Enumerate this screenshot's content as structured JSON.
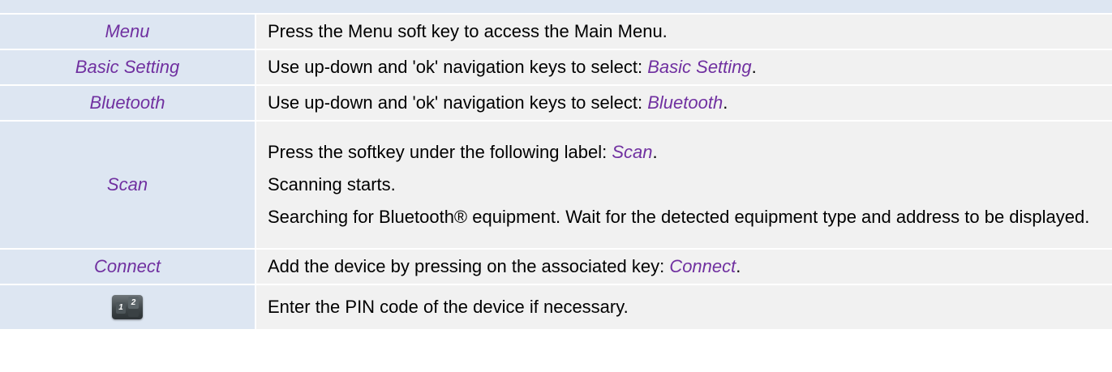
{
  "steps": [
    {
      "label": "Menu",
      "lines": [
        {
          "text": "Press the Menu soft key to access the Main Menu.",
          "keyword": "",
          "suffix": ""
        }
      ]
    },
    {
      "label": "Basic Setting",
      "lines": [
        {
          "text": "Use up-down and 'ok' navigation keys to select: ",
          "keyword": "Basic Setting",
          "suffix": "."
        }
      ]
    },
    {
      "label": "Bluetooth",
      "lines": [
        {
          "text": "Use up-down and 'ok' navigation keys to select: ",
          "keyword": "Bluetooth",
          "suffix": "."
        }
      ]
    },
    {
      "label": "Scan",
      "lines": [
        {
          "text": "Press the softkey under the following label: ",
          "keyword": "Scan",
          "suffix": "."
        },
        {
          "text": "Scanning starts.",
          "keyword": "",
          "suffix": ""
        },
        {
          "text": "Searching for Bluetooth® equipment. Wait for the detected equipment type and address to be displayed.",
          "keyword": "",
          "suffix": ""
        }
      ]
    },
    {
      "label": "Connect",
      "lines": [
        {
          "text": "Add the device by pressing on the associated key: ",
          "keyword": "Connect",
          "suffix": "."
        }
      ]
    },
    {
      "label": "",
      "icon": "keypad-icon",
      "icon_keys": [
        "1",
        "2"
      ],
      "lines": [
        {
          "text": "Enter the PIN code of the device if necessary.",
          "keyword": "",
          "suffix": ""
        }
      ]
    }
  ],
  "colors": {
    "label_bg": "#dde6f2",
    "desc_bg": "#f1f1f1",
    "keyword": "#7030a0"
  }
}
